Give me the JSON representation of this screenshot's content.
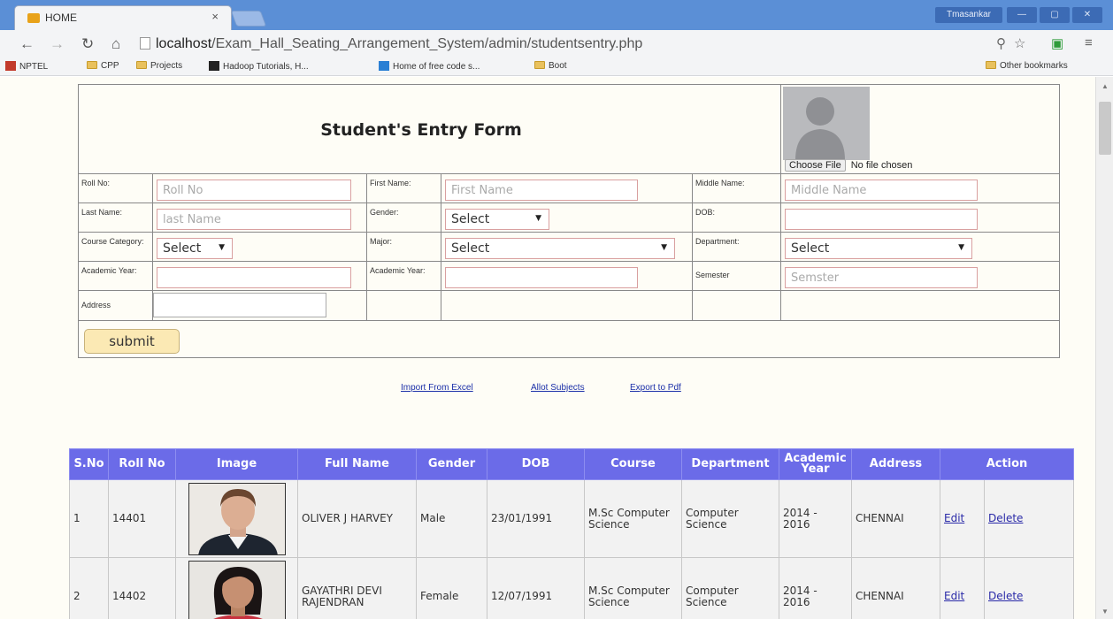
{
  "browser": {
    "tab_title": "HOME",
    "tab_close": "×",
    "user_badge": "Tmasankar",
    "url_host": "localhost",
    "url_path": "/Exam_Hall_Seating_Arrangement_System/admin/studentsentry.php",
    "bookmarks": [
      "NPTEL",
      "CPP",
      "Projects",
      "Hadoop Tutorials, H...",
      "Home of free code s...",
      "Boot"
    ],
    "other_bookmarks": "Other bookmarks"
  },
  "form": {
    "title": "Student's Entry Form",
    "choose_file": "Choose File",
    "no_file": "No file chosen",
    "rows": [
      [
        {
          "label": "Roll No:",
          "type": "input",
          "placeholder": "Roll No"
        },
        {
          "label": "First Name:",
          "type": "input",
          "placeholder": "First Name"
        },
        {
          "label": "Middle Name:",
          "type": "input",
          "placeholder": "Middle Name"
        }
      ],
      [
        {
          "label": "Last Name:",
          "type": "input",
          "placeholder": "last Name"
        },
        {
          "label": "Gender:",
          "type": "select",
          "value": "Select"
        },
        {
          "label": "DOB:",
          "type": "input",
          "placeholder": ""
        }
      ],
      [
        {
          "label": "Course Category:",
          "type": "select",
          "value": "Select"
        },
        {
          "label": "Major:",
          "type": "select",
          "value": "Select"
        },
        {
          "label": "Department:",
          "type": "select",
          "value": "Select"
        }
      ],
      [
        {
          "label": "Academic Year:",
          "type": "input",
          "placeholder": ""
        },
        {
          "label": "Academic Year:",
          "type": "input",
          "placeholder": ""
        },
        {
          "label": "Semester",
          "type": "input",
          "placeholder": "Semster"
        }
      ]
    ],
    "address_label": "Address",
    "submit": "submit"
  },
  "actions": {
    "import": "Import From Excel",
    "allot": "Allot Subjects",
    "export": "Export to Pdf"
  },
  "table": {
    "headers": [
      "S.No",
      "Roll No",
      "Image",
      "Full Name",
      "Gender",
      "DOB",
      "Course",
      "Department",
      "Academic Year",
      "Address",
      "Action"
    ],
    "rows": [
      {
        "sno": "1",
        "roll": "14401",
        "name": "OLIVER J HARVEY",
        "gender": "Male",
        "dob": "23/01/1991",
        "course": "M.Sc Computer Science",
        "dept": "Computer Science",
        "year": "2014 - 2016",
        "address": "CHENNAI",
        "edit": "Edit",
        "delete": "Delete"
      },
      {
        "sno": "2",
        "roll": "14402",
        "name": "GAYATHRI DEVI RAJENDRAN",
        "gender": "Female",
        "dob": "12/07/1991",
        "course": "M.Sc Computer Science",
        "dept": "Computer Science",
        "year": "2014 - 2016",
        "address": "CHENNAI",
        "edit": "Edit",
        "delete": "Delete"
      }
    ]
  }
}
